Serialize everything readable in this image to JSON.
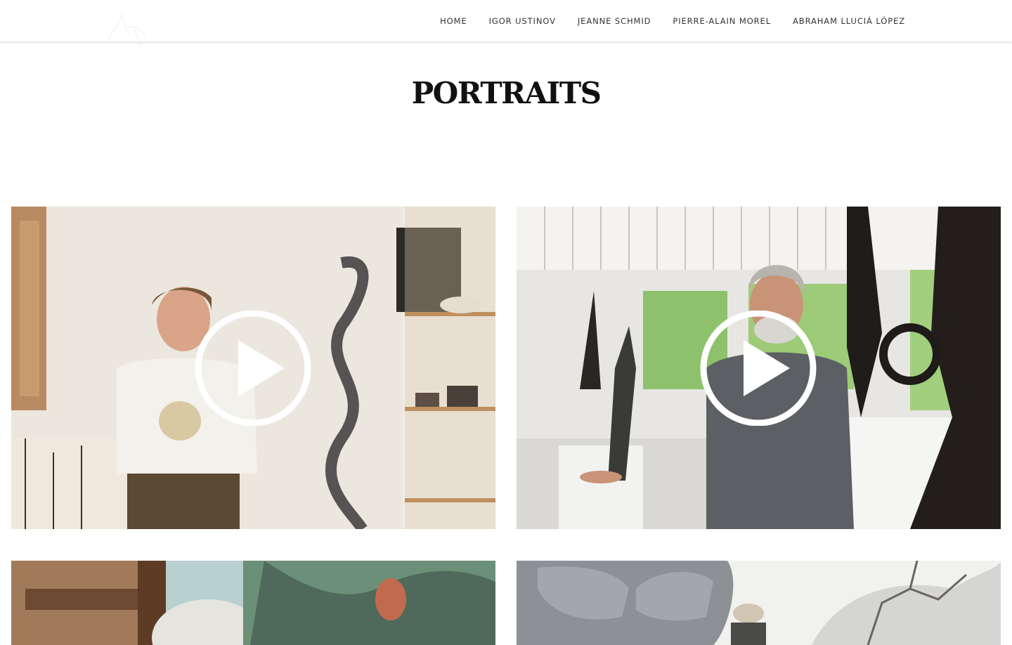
{
  "header": {
    "logo_name": "signature-logo",
    "nav": [
      {
        "label": "HOME"
      },
      {
        "label": "IGOR USTINOV"
      },
      {
        "label": "JEANNE SCHMID"
      },
      {
        "label": "PIERRE-ALAIN MOREL"
      },
      {
        "label": "ABRAHAM LLUCIÁ LÓPEZ"
      }
    ]
  },
  "main": {
    "title": "PORTRAITS",
    "videos": [
      {
        "icon": "play-icon"
      },
      {
        "icon": "play-icon"
      },
      {
        "icon": "none"
      },
      {
        "icon": "none"
      }
    ]
  }
}
